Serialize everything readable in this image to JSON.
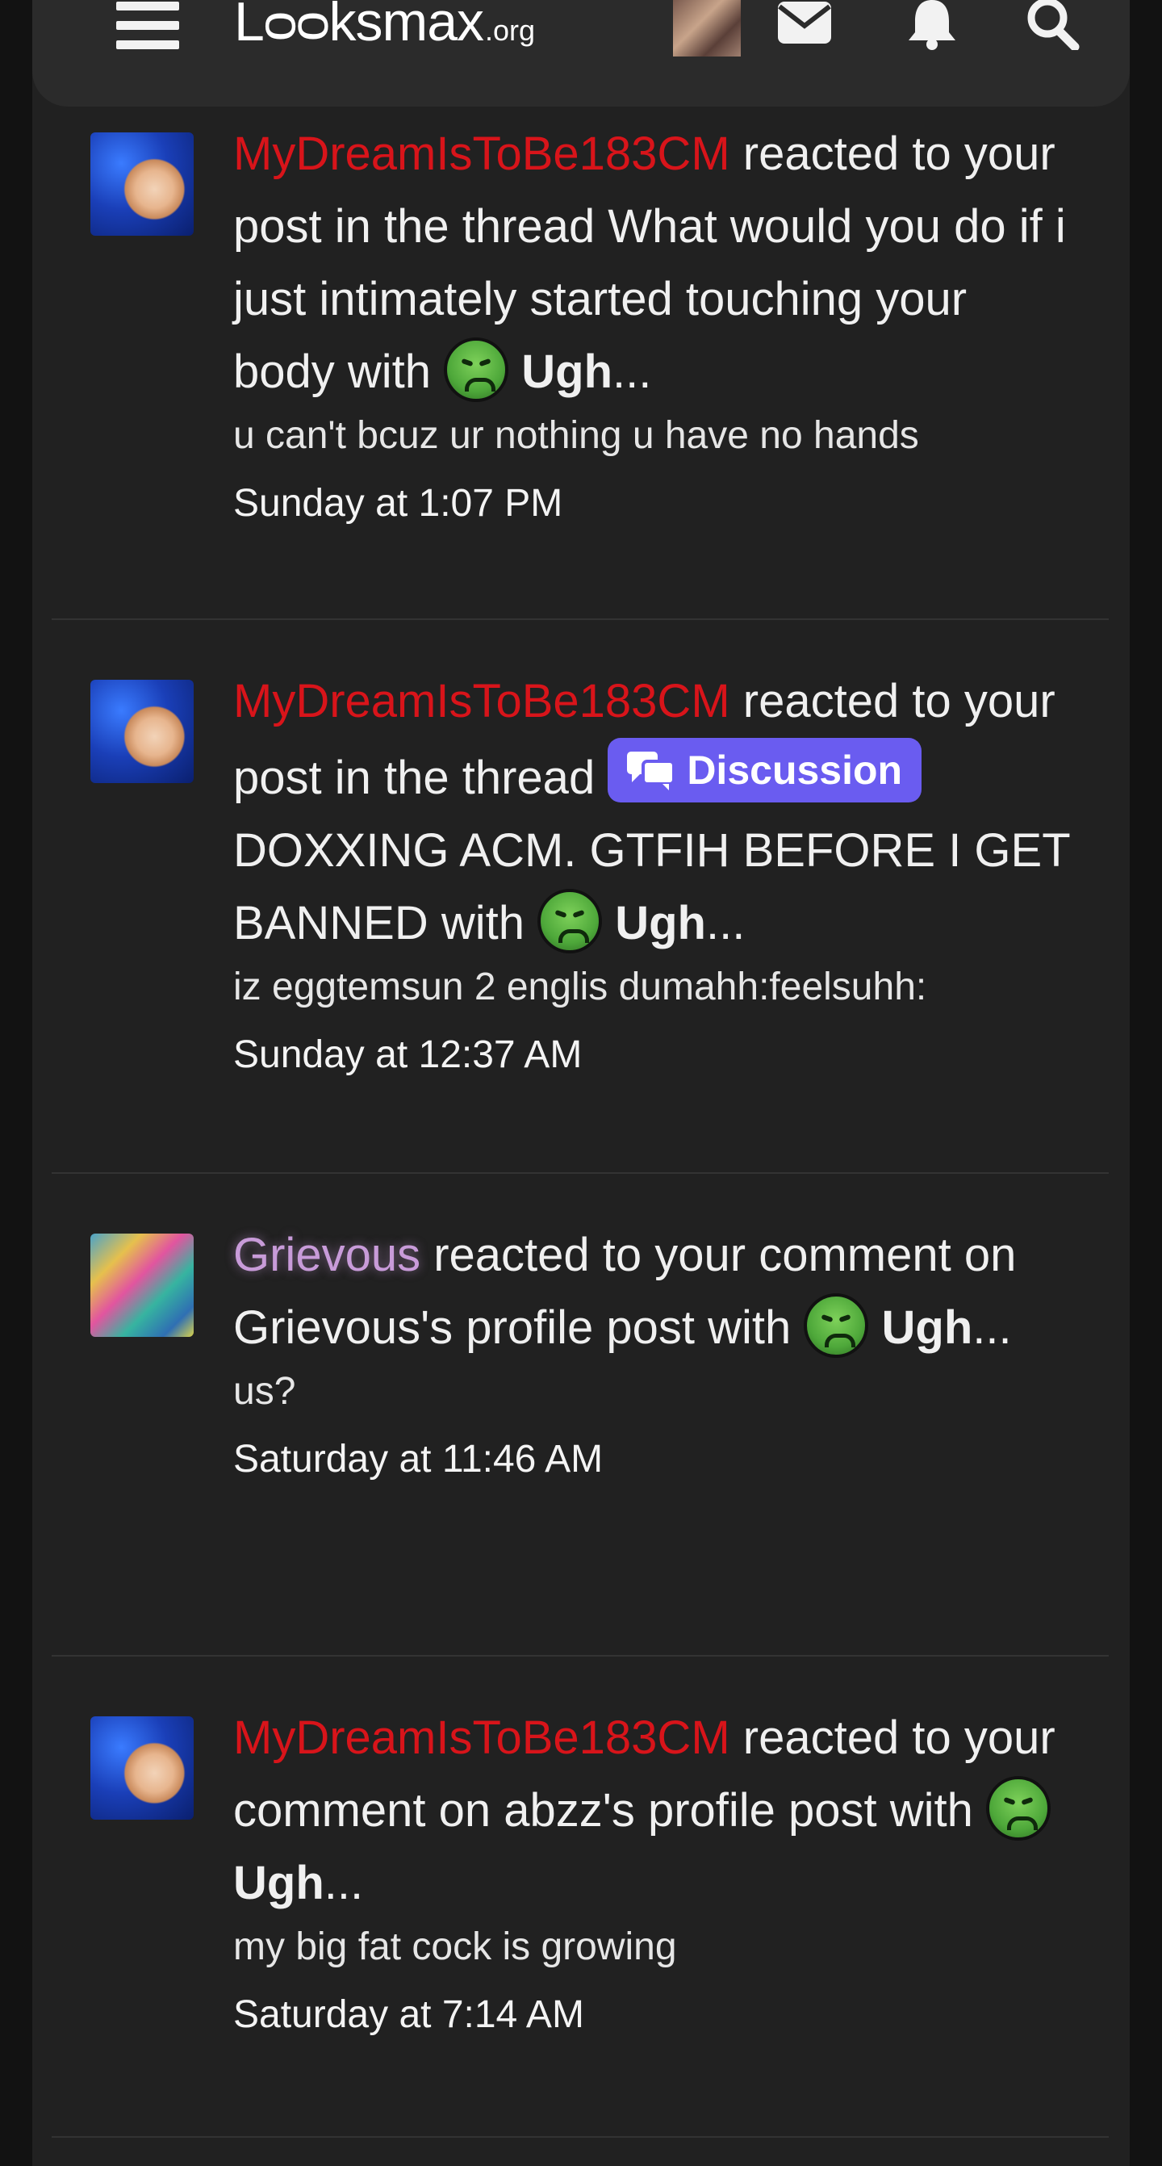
{
  "nav": {
    "logo_main": "Lᴑᴑksmax",
    "logo_suffix": ".org"
  },
  "notifications": [
    {
      "user": "MyDreamIsToBe183CM",
      "user_color": "red",
      "text_before": "reacted to your post in the thread What would you do if i just intimately started touching your body with",
      "reaction": "Ugh",
      "reaction_suffix": "...",
      "snippet": "u can't bcuz ur nothing u have no hands",
      "time": "Sunday at 1:07 PM"
    },
    {
      "user": "MyDreamIsToBe183CM",
      "user_color": "red",
      "text_before": "reacted to your post in the thread",
      "prefix": "Discussion",
      "text_after": "DOXXING ACM. GTFIH BEFORE I GET BANNED with",
      "reaction": "Ugh",
      "reaction_suffix": "...",
      "snippet": "iz eggtemsun 2 englis dumahh:feelsuhh:",
      "time": "Sunday at 12:37 AM"
    },
    {
      "user": "Grievous",
      "user_color": "purple",
      "text_before": "reacted to your comment on Grievous's profile post with",
      "reaction": "Ugh",
      "reaction_suffix": "...",
      "snippet": "us?",
      "time": "Saturday at 11:46 AM"
    },
    {
      "user": "MyDreamIsToBe183CM",
      "user_color": "red",
      "text_before": "reacted to your comment on abzz's profile post with",
      "reaction": "Ugh",
      "reaction_suffix": "...",
      "snippet": "my big fat cock is growing",
      "time": "Saturday at 7:14 AM"
    }
  ],
  "icons": {
    "menu": "hamburger-icon",
    "mail": "envelope-icon",
    "alerts": "bell-icon",
    "search": "search-icon",
    "reaction": "nauseated-face-icon",
    "prefix": "chat-bubbles-icon"
  }
}
